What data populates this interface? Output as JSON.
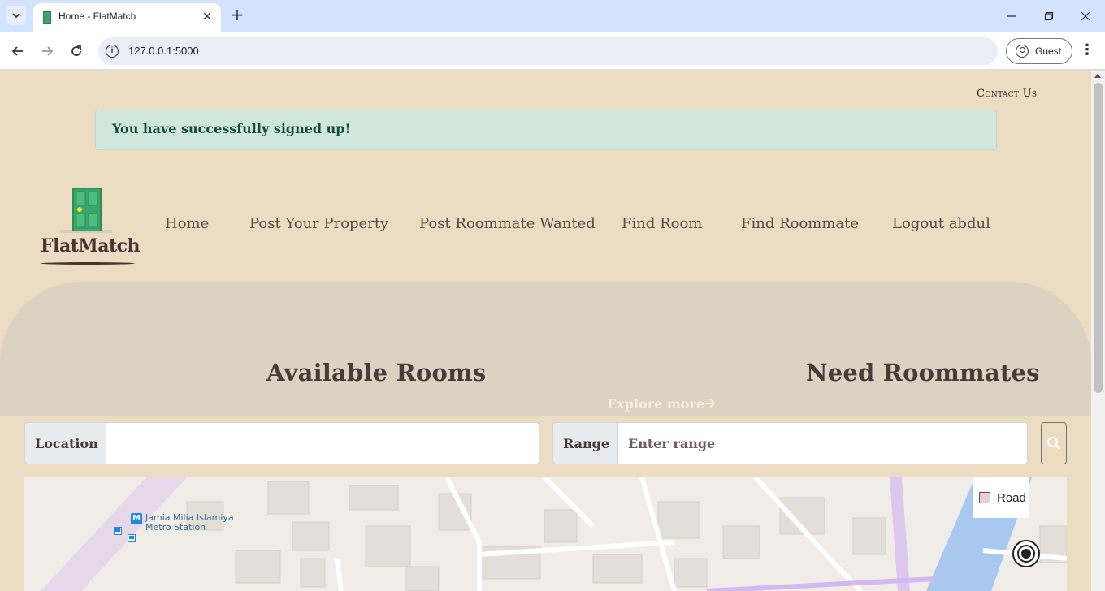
{
  "browser": {
    "tab_title": "Home - FlatMatch",
    "url": "127.0.0.1:5000",
    "profile_label": "Guest"
  },
  "page": {
    "contact_link": "Contact Us",
    "flash_message": "You have successfully signed up!",
    "logo_text": "FlatMatch",
    "nav": [
      {
        "label": "Home"
      },
      {
        "label": "Post Your Property"
      },
      {
        "label": "Post Roommate Wanted"
      },
      {
        "label": "Find Room"
      },
      {
        "label": "Find Roommate"
      },
      {
        "label": "Logout abdul"
      }
    ],
    "hero": {
      "available_rooms": "Available Rooms",
      "need_roommates": "Need Roommates",
      "explore_more": "Explore more"
    },
    "search": {
      "location_label": "Location",
      "location_value": "",
      "range_label": "Range",
      "range_placeholder": "Enter range"
    },
    "map": {
      "road_toggle": "Road",
      "station_name_line1": "Jamia Milia Islamiya",
      "station_name_line2": "Metro Station",
      "metro_badge": "M"
    }
  },
  "icons": {
    "tab_menu": "chevron-down-icon",
    "favicon": "door-icon",
    "close": "close-icon",
    "new_tab": "plus-icon",
    "back": "back-arrow-icon",
    "forward": "forward-arrow-icon",
    "reload": "reload-icon",
    "site_info": "info-icon",
    "profile": "person-icon",
    "menu": "kebab-icon",
    "search": "search-icon",
    "locate": "locate-icon"
  },
  "colors": {
    "page_bg": "#ebdcc2",
    "hero_bg": "#dcd2c2",
    "flash_bg": "#d1e7dd",
    "flash_text": "#0f5132",
    "door_green": "#3aa56c"
  }
}
